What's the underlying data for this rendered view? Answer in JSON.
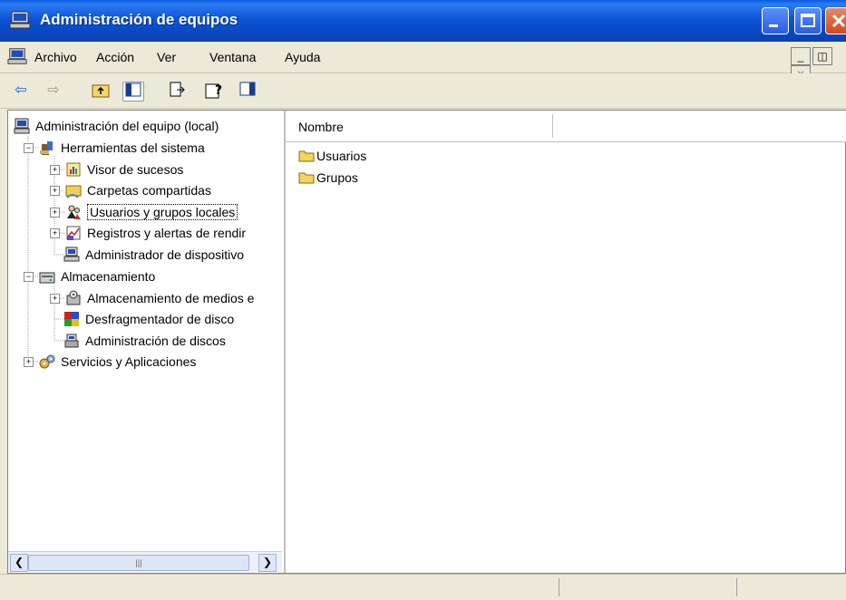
{
  "window": {
    "title": "Administración de equipos"
  },
  "menu": {
    "items": [
      {
        "label": "Archivo"
      },
      {
        "label": "Acción"
      },
      {
        "label": "Ver"
      },
      {
        "label": "Ventana"
      },
      {
        "label": "Ayuda"
      }
    ]
  },
  "toolbar": {
    "icons": [
      "back-arrow-icon",
      "forward-arrow-icon",
      "up-folder-icon",
      "show-hide-tree-icon",
      "export-list-icon",
      "help-icon",
      "action-pane-icon"
    ]
  },
  "tree": {
    "root": "Administración del equipo (local)",
    "items": [
      {
        "label": "Herramientas del sistema"
      },
      {
        "label": "Visor de sucesos"
      },
      {
        "label": "Carpetas compartidas"
      },
      {
        "label": "Usuarios y grupos locales"
      },
      {
        "label": "Registros y alertas de rendir"
      },
      {
        "label": "Administrador de dispositivo"
      },
      {
        "label": "Almacenamiento"
      },
      {
        "label": "Almacenamiento de medios e"
      },
      {
        "label": "Desfragmentador de disco"
      },
      {
        "label": "Administración de discos"
      },
      {
        "label": "Servicios y Aplicaciones"
      }
    ]
  },
  "list": {
    "column_header": "Nombre",
    "items": [
      {
        "label": "Usuarios"
      },
      {
        "label": "Grupos"
      }
    ]
  },
  "colors": {
    "titlebar": "#0a5ce0",
    "window_bg": "#ece9d8",
    "close_button": "#d2461c"
  }
}
